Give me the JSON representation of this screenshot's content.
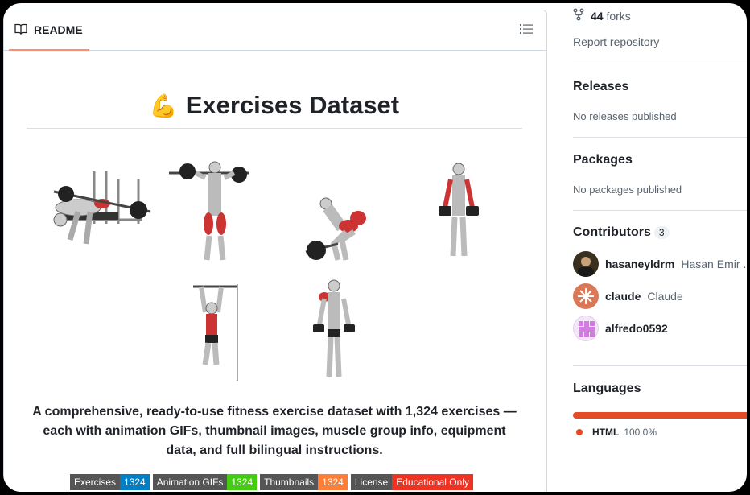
{
  "readme": {
    "tab_label": "README",
    "title": "Exercises Dataset",
    "title_emoji": "💪",
    "description": "A comprehensive, ready-to-use fitness exercise dataset with 1,324 exercises — each with animation GIFs, thumbnail images, muscle group info, equipment data, and full bilingual instructions.",
    "figures": [
      "bench-press",
      "barbell-squat",
      "deadlift",
      "dumbbell-shrug",
      "pull-up",
      "dumbbell-lateral-raise"
    ],
    "badges": [
      {
        "key": "Exercises",
        "value": "1324",
        "color": "#007ec6"
      },
      {
        "key": "Animation GIFs",
        "value": "1324",
        "color": "#4c1"
      },
      {
        "key": "Thumbnails",
        "value": "1324",
        "color": "#fe7d37"
      },
      {
        "key": "License",
        "value": "Educational Only",
        "color": "#e05d44"
      }
    ]
  },
  "sidebar": {
    "forks_count": "44",
    "forks_label": "forks",
    "report": "Report repository",
    "releases": {
      "title": "Releases",
      "empty": "No releases published"
    },
    "packages": {
      "title": "Packages",
      "empty": "No packages published"
    },
    "contributors": {
      "title": "Contributors",
      "count": "3",
      "items": [
        {
          "login": "hasaneyldrm",
          "name": "Hasan Emir ..."
        },
        {
          "login": "claude",
          "name": "Claude"
        },
        {
          "login": "alfredo0592",
          "name": ""
        }
      ]
    },
    "languages": {
      "title": "Languages",
      "items": [
        {
          "name": "HTML",
          "percent": "100.0%",
          "color": "#e34c26"
        }
      ]
    }
  }
}
